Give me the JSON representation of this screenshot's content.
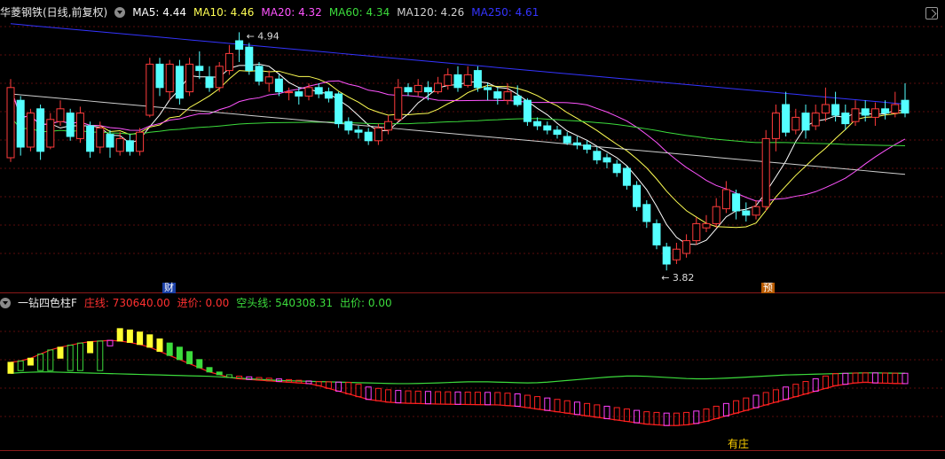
{
  "header": {
    "stock_title": "华菱钢铁(日线,前复权)",
    "ma5": "MA5: 4.44",
    "ma10": "MA10: 4.46",
    "ma20": "MA20: 4.32",
    "ma60": "MA60: 4.34",
    "ma120": "MA120: 4.26",
    "ma250": "MA250: 4.61"
  },
  "indicator_header": {
    "name": "一钻四色柱F",
    "zhuang": "庄线: 730640.00",
    "jinjia": "进价: 0.00",
    "kongtou": "空头线: 540308.31",
    "chujia": "出价: 0.00"
  },
  "annotations": {
    "high": "4.94",
    "low": "3.82",
    "fin_tag": "财",
    "pre_tag": "预",
    "zhuang_tag": "有庄"
  },
  "colors": {
    "up": "#ff3b3b",
    "down": "#54ffff",
    "ma5": "#ffffff",
    "ma10": "#ffff54",
    "ma20": "#ff54ff",
    "ma60": "#3cdc3c",
    "ma120": "#cfcfcf",
    "ma250": "#3434ff",
    "zhuang_line": "#ff2020",
    "kongtou_line": "#3cdc3c",
    "bar_yellow": "#ffff30",
    "bar_magenta": "#ff40ff",
    "bar_green": "#3cdc3c",
    "bar_red": "#ff2020"
  },
  "chart_data": [
    {
      "type": "candlestick",
      "title": "华菱钢铁(日线,前复权)",
      "ylim": [
        3.8,
        5.0
      ],
      "annotated_high": 4.94,
      "annotated_low": 3.82,
      "candles": [
        [
          4.35,
          4.68,
          4.72,
          4.33
        ],
        [
          4.62,
          4.4,
          4.64,
          4.36
        ],
        [
          4.4,
          4.56,
          4.58,
          4.38
        ],
        [
          4.58,
          4.38,
          4.6,
          4.34
        ],
        [
          4.4,
          4.53,
          4.56,
          4.39
        ],
        [
          4.52,
          4.58,
          4.62,
          4.5
        ],
        [
          4.56,
          4.45,
          4.58,
          4.43
        ],
        [
          4.44,
          4.56,
          4.59,
          4.42
        ],
        [
          4.5,
          4.38,
          4.52,
          4.35
        ],
        [
          4.4,
          4.49,
          4.52,
          4.37
        ],
        [
          4.46,
          4.4,
          4.48,
          4.35
        ],
        [
          4.38,
          4.44,
          4.47,
          4.36
        ],
        [
          4.43,
          4.38,
          4.46,
          4.36
        ],
        [
          4.38,
          4.47,
          4.49,
          4.36
        ],
        [
          4.55,
          4.79,
          4.82,
          4.54
        ],
        [
          4.79,
          4.68,
          4.82,
          4.64
        ],
        [
          4.66,
          4.79,
          4.81,
          4.62
        ],
        [
          4.78,
          4.63,
          4.81,
          4.6
        ],
        [
          4.66,
          4.79,
          4.82,
          4.64
        ],
        [
          4.78,
          4.76,
          4.85,
          4.72
        ],
        [
          4.73,
          4.68,
          4.78,
          4.66
        ],
        [
          4.68,
          4.78,
          4.8,
          4.66
        ],
        [
          4.76,
          4.84,
          4.88,
          4.74
        ],
        [
          4.9,
          4.86,
          4.94,
          4.8
        ],
        [
          4.87,
          4.76,
          4.89,
          4.74
        ],
        [
          4.78,
          4.71,
          4.8,
          4.69
        ],
        [
          4.7,
          4.73,
          4.76,
          4.66
        ],
        [
          4.72,
          4.66,
          4.74,
          4.64
        ],
        [
          4.66,
          4.66,
          4.68,
          4.62
        ],
        [
          4.66,
          4.64,
          4.68,
          4.6
        ],
        [
          4.64,
          4.68,
          4.7,
          4.62
        ],
        [
          4.68,
          4.65,
          4.7,
          4.63
        ],
        [
          4.66,
          4.63,
          4.68,
          4.61
        ],
        [
          4.65,
          4.51,
          4.66,
          4.49
        ],
        [
          4.52,
          4.48,
          4.54,
          4.46
        ],
        [
          4.48,
          4.47,
          4.5,
          4.44
        ],
        [
          4.47,
          4.43,
          4.49,
          4.41
        ],
        [
          4.43,
          4.49,
          4.51,
          4.41
        ],
        [
          4.48,
          4.52,
          4.55,
          4.46
        ],
        [
          4.53,
          4.68,
          4.72,
          4.52
        ],
        [
          4.68,
          4.66,
          4.7,
          4.64
        ],
        [
          4.66,
          4.69,
          4.72,
          4.64
        ],
        [
          4.68,
          4.66,
          4.71,
          4.62
        ],
        [
          4.66,
          4.7,
          4.73,
          4.65
        ],
        [
          4.69,
          4.74,
          4.77,
          4.67
        ],
        [
          4.74,
          4.68,
          4.78,
          4.66
        ],
        [
          4.69,
          4.74,
          4.78,
          4.68
        ],
        [
          4.76,
          4.68,
          4.78,
          4.66
        ],
        [
          4.68,
          4.67,
          4.7,
          4.62
        ],
        [
          4.66,
          4.63,
          4.68,
          4.6
        ],
        [
          4.62,
          4.66,
          4.7,
          4.6
        ],
        [
          4.64,
          4.6,
          4.69,
          4.59
        ],
        [
          4.62,
          4.52,
          4.63,
          4.5
        ],
        [
          4.52,
          4.5,
          4.54,
          4.48
        ],
        [
          4.5,
          4.48,
          4.52,
          4.46
        ],
        [
          4.48,
          4.46,
          4.5,
          4.44
        ],
        [
          4.45,
          4.42,
          4.47,
          4.41
        ],
        [
          4.42,
          4.41,
          4.45,
          4.39
        ],
        [
          4.41,
          4.39,
          4.43,
          4.37
        ],
        [
          4.38,
          4.34,
          4.4,
          4.32
        ],
        [
          4.35,
          4.33,
          4.37,
          4.3
        ],
        [
          4.32,
          4.28,
          4.34,
          4.26
        ],
        [
          4.3,
          4.22,
          4.31,
          4.2
        ],
        [
          4.22,
          4.12,
          4.24,
          4.1
        ],
        [
          4.13,
          4.05,
          4.15,
          4.02
        ],
        [
          4.04,
          3.94,
          4.06,
          3.92
        ],
        [
          3.93,
          3.85,
          3.95,
          3.82
        ],
        [
          3.87,
          3.92,
          3.95,
          3.85
        ],
        [
          3.9,
          3.96,
          3.99,
          3.88
        ],
        [
          3.96,
          4.04,
          4.07,
          3.94
        ],
        [
          4.02,
          4.04,
          4.08,
          4.0
        ],
        [
          4.04,
          4.12,
          4.16,
          4.02
        ],
        [
          4.11,
          4.2,
          4.24,
          4.09
        ],
        [
          4.18,
          4.1,
          4.2,
          4.06
        ],
        [
          4.1,
          4.08,
          4.14,
          4.05
        ],
        [
          4.08,
          4.12,
          4.15,
          4.06
        ],
        [
          4.12,
          4.44,
          4.48,
          4.1
        ],
        [
          4.44,
          4.56,
          4.6,
          4.38
        ],
        [
          4.6,
          4.47,
          4.66,
          4.45
        ],
        [
          4.48,
          4.54,
          4.58,
          4.46
        ],
        [
          4.56,
          4.48,
          4.6,
          4.44
        ],
        [
          4.5,
          4.56,
          4.6,
          4.48
        ],
        [
          4.56,
          4.6,
          4.68,
          4.52
        ],
        [
          4.6,
          4.55,
          4.66,
          4.52
        ],
        [
          4.56,
          4.51,
          4.6,
          4.48
        ],
        [
          4.52,
          4.58,
          4.62,
          4.5
        ],
        [
          4.58,
          4.55,
          4.62,
          4.52
        ],
        [
          4.54,
          4.58,
          4.61,
          4.5
        ],
        [
          4.58,
          4.56,
          4.62,
          4.53
        ],
        [
          4.56,
          4.6,
          4.66,
          4.54
        ],
        [
          4.62,
          4.56,
          4.7,
          4.54
        ]
      ],
      "series": [
        {
          "name": "MA5",
          "value": 4.44
        },
        {
          "name": "MA10",
          "value": 4.46
        },
        {
          "name": "MA20",
          "value": 4.32
        },
        {
          "name": "MA60",
          "value": 4.34
        },
        {
          "name": "MA120",
          "value": 4.26
        },
        {
          "name": "MA250",
          "value": 4.61
        }
      ]
    },
    {
      "type": "bar",
      "title": "一钻四色柱F",
      "ylim": [
        0,
        1000000
      ],
      "zhuang_line": [
        620000,
        630000,
        650000,
        680000,
        710000,
        730000,
        745000,
        760000,
        770000,
        775000,
        780000,
        775000,
        765000,
        750000,
        730000,
        700000,
        670000,
        640000,
        610000,
        580000,
        550000,
        530000,
        510000,
        500000,
        495000,
        490000,
        485000,
        480000,
        475000,
        470000,
        465000,
        450000,
        430000,
        410000,
        390000,
        370000,
        350000,
        340000,
        330000,
        325000,
        322000,
        320000,
        318000,
        316000,
        315000,
        314000,
        313000,
        312000,
        311000,
        310000,
        305000,
        300000,
        290000,
        280000,
        270000,
        260000,
        250000,
        240000,
        230000,
        220000,
        210000,
        200000,
        190000,
        180000,
        170000,
        165000,
        160000,
        160000,
        165000,
        175000,
        190000,
        210000,
        230000,
        250000,
        270000,
        290000,
        310000,
        330000,
        350000,
        370000,
        390000,
        410000,
        430000,
        450000,
        460000,
        470000,
        475000,
        470000,
        468000,
        466000,
        465000
      ],
      "kongtou_line": [
        540000,
        545000,
        548000,
        550000,
        550000,
        548000,
        546000,
        544000,
        542000,
        540000,
        538000,
        536000,
        534000,
        532000,
        530000,
        528000,
        526000,
        524000,
        522000,
        520000,
        518000,
        514000,
        510000,
        505000,
        500000,
        496000,
        492000,
        488000,
        486000,
        484000,
        482000,
        480000,
        478000,
        476000,
        474000,
        472000,
        470000,
        468000,
        466000,
        465000,
        465000,
        466000,
        468000,
        470000,
        473000,
        476000,
        478000,
        478000,
        478000,
        476000,
        474000,
        472000,
        470000,
        472000,
        476000,
        482000,
        488000,
        494000,
        500000,
        506000,
        512000,
        516000,
        520000,
        520000,
        518000,
        514000,
        510000,
        506000,
        502000,
        500000,
        500000,
        502000,
        505000,
        508000,
        512000,
        516000,
        520000,
        524000,
        528000,
        530000,
        532000,
        534000,
        536000,
        538000,
        540000,
        542000,
        543000,
        543000,
        542000,
        541000,
        540308
      ],
      "bars": [
        {
          "color": "yellow",
          "value": 540000
        },
        {
          "color": "green",
          "value": 560000
        },
        {
          "color": "yellow",
          "value": 600000
        },
        {
          "color": "green",
          "value": 560000
        },
        {
          "color": "green",
          "value": 560000
        },
        {
          "color": "yellow",
          "value": 650000
        },
        {
          "color": "green",
          "value": 560000
        },
        {
          "color": "green",
          "value": 560000
        },
        {
          "color": "yellow",
          "value": 690000
        },
        {
          "color": "green",
          "value": 560000
        },
        {
          "color": "magenta",
          "value": 740000
        }
      ]
    }
  ]
}
